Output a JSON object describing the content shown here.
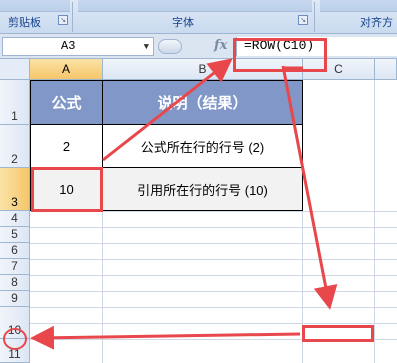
{
  "ribbon": {
    "groups": [
      {
        "label": "剪贴板"
      },
      {
        "label": "字体"
      },
      {
        "label": "对齐方"
      }
    ]
  },
  "formula_bar": {
    "name_box": "A3",
    "fx_label": "fx",
    "formula": "=ROW(C10)"
  },
  "sheet": {
    "columns": [
      "A",
      "B",
      "C"
    ],
    "rows": [
      "1",
      "2",
      "3",
      "4",
      "5",
      "6",
      "7",
      "8",
      "9",
      "10",
      "11"
    ],
    "selected_cell": "A3",
    "table": {
      "headers": [
        "公式",
        "说明（结果）"
      ],
      "rows": [
        [
          "2",
          "公式所在行的行号 (2)"
        ],
        [
          "10",
          "引用所在行的行号 (10)"
        ]
      ]
    }
  },
  "annotations": {
    "color": "#e8474b",
    "highlighted_row_header": "10"
  },
  "colors": {
    "header_fill": "#8097c8",
    "header_text": "#ffffff",
    "selection_fill": "#f5c66a"
  }
}
